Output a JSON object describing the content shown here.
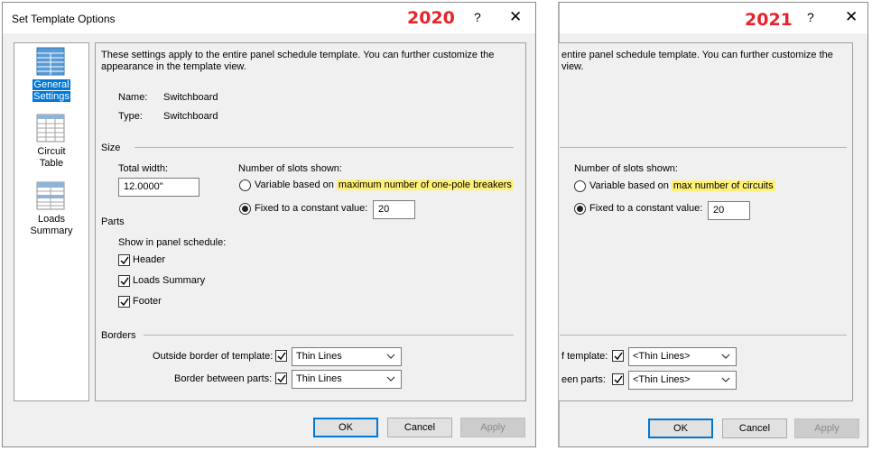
{
  "left_dialog": {
    "title": "Set Template Options",
    "version": "2020",
    "help": "?",
    "close": "✕",
    "sidebar": [
      {
        "label_line1": "General",
        "label_line2": "Settings",
        "selected": true
      },
      {
        "label_line1": "Circuit",
        "label_line2": "Table",
        "selected": false
      },
      {
        "label_line1": "Loads",
        "label_line2": "Summary",
        "selected": false
      }
    ],
    "intro_line1": "These settings apply to the entire panel schedule template. You can further customize the",
    "intro_line2": "appearance in the template view.",
    "name_label": "Name:",
    "name_value": "Switchboard",
    "type_label": "Type:",
    "type_value": "Switchboard",
    "size_header": "Size",
    "total_width_label": "Total width:",
    "total_width_value": "12.0000\"",
    "slots_label": "Number of slots shown:",
    "variable_prefix": "Variable based on ",
    "variable_highlight": "maximum number of one-pole breakers",
    "fixed_label": "Fixed to a constant value:",
    "fixed_value": "20",
    "parts_header": "Parts",
    "show_label": "Show in panel schedule:",
    "parts": [
      "Header",
      "Loads Summary",
      "Footer"
    ],
    "borders_header": "Borders",
    "outside_border_label": "Outside border of template:",
    "outside_border_value": "Thin Lines",
    "between_label": "Border between parts:",
    "between_value": "Thin Lines",
    "ok": "OK",
    "cancel": "Cancel",
    "apply": "Apply"
  },
  "right_dialog": {
    "version": "2021",
    "help": "?",
    "close": "✕",
    "intro_line1": "entire panel schedule template. You can further customize the",
    "intro_line2": "view.",
    "slots_label": "Number of slots shown:",
    "variable_prefix": "Variable based on ",
    "variable_highlight": "max number of circuits",
    "fixed_label": "Fixed to a constant value:",
    "fixed_value": "20",
    "outside_border_label": "f template:",
    "outside_border_value": "<Thin Lines>",
    "between_label": "een parts:",
    "between_value": "<Thin Lines>",
    "ok": "OK",
    "cancel": "Cancel",
    "apply": "Apply"
  }
}
